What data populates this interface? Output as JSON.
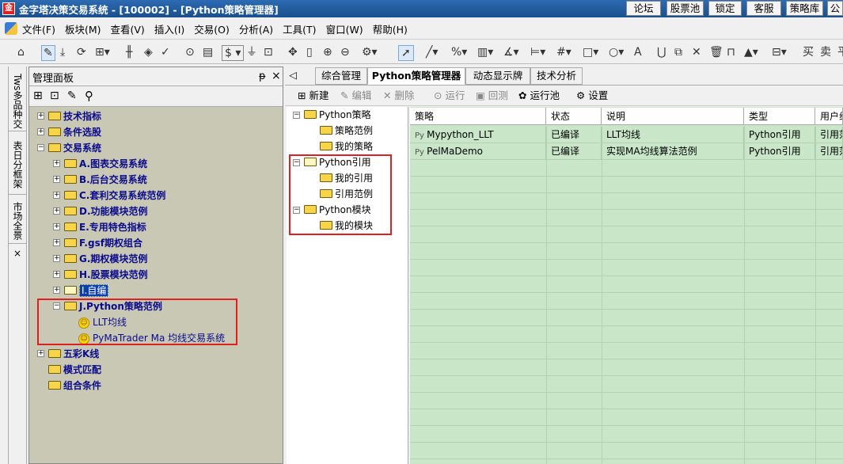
{
  "window": {
    "title": "金字塔决策交易系统 - [100002] - [Python策略管理器]",
    "buttons": [
      "论坛",
      "股票池",
      "锁定",
      "客服",
      "策略库",
      "公"
    ]
  },
  "menu": [
    "文件(F)",
    "板块(M)",
    "查看(V)",
    "插入(I)",
    "交易(O)",
    "分析(A)",
    "工具(T)",
    "窗口(W)",
    "帮助(H)"
  ],
  "toolbar_right": [
    "买",
    "卖",
    "平"
  ],
  "left_tabs": [
    "Tws多品种交",
    "表日分框架",
    "市场全景"
  ],
  "left_tabs_close": "×",
  "panel": {
    "title": "管理面板",
    "pin": "ᵽ",
    "close": "×"
  },
  "tree": [
    {
      "label": "技术指标",
      "expander": "+"
    },
    {
      "label": "条件选股",
      "expander": "+"
    },
    {
      "label": "交易系统",
      "expander": "−"
    },
    {
      "label": "A.图表交易系统",
      "expander": "+"
    },
    {
      "label": "B.后台交易系统",
      "expander": "+"
    },
    {
      "label": "C.套利交易系统范例",
      "expander": "+"
    },
    {
      "label": "D.功能模块范例",
      "expander": "+"
    },
    {
      "label": "E.专用特色指标",
      "expander": "+"
    },
    {
      "label": "F.gsf期权组合",
      "expander": "+"
    },
    {
      "label": "G.期权模块范例",
      "expander": "+"
    },
    {
      "label": "H.股票模块范例",
      "expander": "+"
    },
    {
      "label": "I.自编",
      "expander": "+"
    },
    {
      "label": "J.Python策略范例",
      "expander": "−"
    },
    {
      "label": "LLT均线",
      "expander": ""
    },
    {
      "label": "PyMaTrader Ma 均线交易系统",
      "expander": ""
    },
    {
      "label": "五彩K线",
      "expander": "+"
    },
    {
      "label": "模式匹配",
      "expander": ""
    },
    {
      "label": "组合条件",
      "expander": ""
    }
  ],
  "tabs": [
    "综合管理",
    "Python策略管理器",
    "动态显示牌",
    "技术分析"
  ],
  "tab_nav": "◁",
  "actions": [
    "新建",
    "编辑",
    "删除",
    "运行",
    "回测",
    "运行池",
    "设置"
  ],
  "pytree": [
    {
      "label": "Python策略",
      "expander": "−"
    },
    {
      "label": "策略范例",
      "expander": ""
    },
    {
      "label": "我的策略",
      "expander": ""
    },
    {
      "label": "Python引用",
      "expander": "−"
    },
    {
      "label": "我的引用",
      "expander": ""
    },
    {
      "label": "引用范例",
      "expander": ""
    },
    {
      "label": "Python模块",
      "expander": "−"
    },
    {
      "label": "我的模块",
      "expander": ""
    }
  ],
  "table": {
    "columns": [
      "策略",
      "状态",
      "说明",
      "类型",
      "用户组"
    ],
    "rows": [
      [
        "Mypython_LLT",
        "已编译",
        "LLT均线",
        "Python引用",
        "引用范例"
      ],
      [
        "PelMaDemo",
        "已编译",
        "实现MA均线算法范例",
        "Python引用",
        "引用范例"
      ]
    ]
  },
  "colors": {
    "panel_bg": "#c8c8b5",
    "grid_bg": "#c9e6c9",
    "highlight": "#e02020",
    "tree_text": "#0a0a8c"
  }
}
